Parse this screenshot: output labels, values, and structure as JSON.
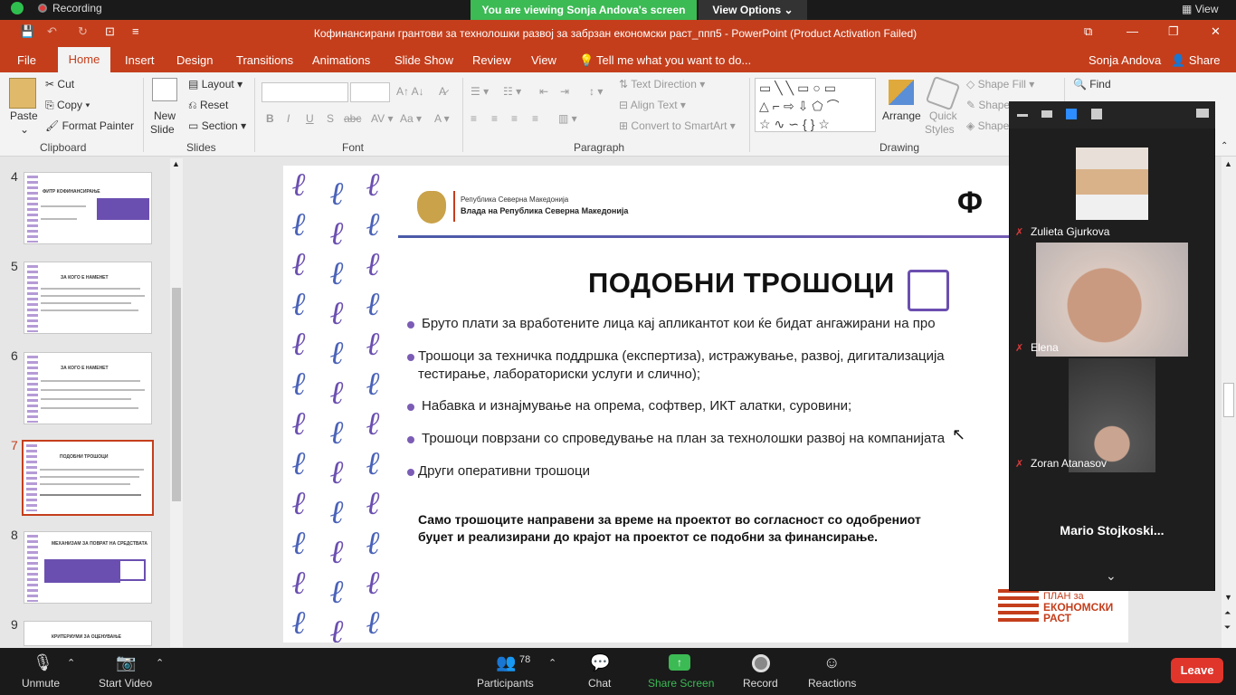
{
  "zoom_top": {
    "recording": "Recording",
    "viewing": "You are viewing Sonja Andova's screen",
    "view_options": "View Options",
    "view": "View"
  },
  "window": {
    "title": "Кофинансирани грантови за технолошки развој за забрзан економски раст_ппп5 - PowerPoint (Product Activation Failed)",
    "user": "Sonja Andova",
    "share": "Share"
  },
  "tabs": [
    "File",
    "Home",
    "Insert",
    "Design",
    "Transitions",
    "Animations",
    "Slide Show",
    "Review",
    "View"
  ],
  "tell_me": "Tell me what you want to do...",
  "ribbon": {
    "paste": "Paste",
    "cut": "Cut",
    "copy": "Copy",
    "format_painter": "Format Painter",
    "clipboard": "Clipboard",
    "new_slide_1": "New",
    "new_slide_2": "Slide",
    "layout": "Layout",
    "reset": "Reset",
    "section": "Section",
    "slides": "Slides",
    "font": "Font",
    "text_direction": "Text Direction",
    "align_text": "Align Text",
    "convert_smartart": "Convert to SmartArt",
    "paragraph": "Paragraph",
    "arrange": "Arrange",
    "quick_styles_1": "Quick",
    "quick_styles_2": "Styles",
    "shape_fill": "Shape Fill",
    "shape_outline": "Shape",
    "shape_effects": "Shape",
    "drawing": "Drawing",
    "find": "Find"
  },
  "thumbnails": [
    {
      "num": "4",
      "title": "ФИТР КОФИНАНСИРАЊЕ"
    },
    {
      "num": "5",
      "title": "ЗА КОГО Е НАМЕНЕТ"
    },
    {
      "num": "6",
      "title": "ЗА КОГО Е НАМЕНЕТ"
    },
    {
      "num": "7",
      "title": "ПОДОБНИ ТРОШОЦИ"
    },
    {
      "num": "8",
      "title": "МЕХАНИЗАМ ЗА ПОВРАТ НА СРЕДСТВАТА"
    },
    {
      "num": "9",
      "title": "КРИТЕРИУМИ ЗА ОЦЕНУВАЊЕ"
    }
  ],
  "slide": {
    "gov_line1": "Република Северна Македонија",
    "gov_line2": "Влада на Република Северна Македонија",
    "title": "ПОДОБНИ ТРОШОЦИ",
    "bullets": [
      "Бруто плати за вработените лица кај апликантот кои ќе бидат ангажирани на про",
      "Трошоци за техничка поддршка (експертиза), истражување, развој, дигитализација",
      "тестирање, лабораториски услуги и слично);",
      "Набавка и изнајмување на опрема, софтвер, ИКТ алатки, суровини;",
      "Трошоци поврзани со спроведување на план за технолошки развој на компанијата",
      "Други оперативни трошоци"
    ],
    "note_line1": "Само трошоците направени за време на проектот во согласност со одобрениот",
    "note_line2": "буџет и реализирани до крајот на проектот се подобни за финансирање.",
    "logo_line1": "ПЛАН за",
    "logo_line2": "ЕКОНОМСКИ",
    "logo_line3": "РАСТ"
  },
  "participants_panel": [
    {
      "name": "Zulieta Gjurkova"
    },
    {
      "name": "Elena"
    },
    {
      "name": "Zoran Atanasov"
    },
    {
      "name": "Mario  Stojkoski..."
    }
  ],
  "zoom_bottom": {
    "unmute": "Unmute",
    "start_video": "Start Video",
    "participants": "Participants",
    "participants_count": "78",
    "chat": "Chat",
    "share_screen": "Share Screen",
    "record": "Record",
    "reactions": "Reactions",
    "leave": "Leave"
  },
  "colors": {
    "accent": "#c43e1c",
    "purple": "#7b5cb5",
    "zoom_green": "#3cba54",
    "leave_red": "#e0352b"
  }
}
